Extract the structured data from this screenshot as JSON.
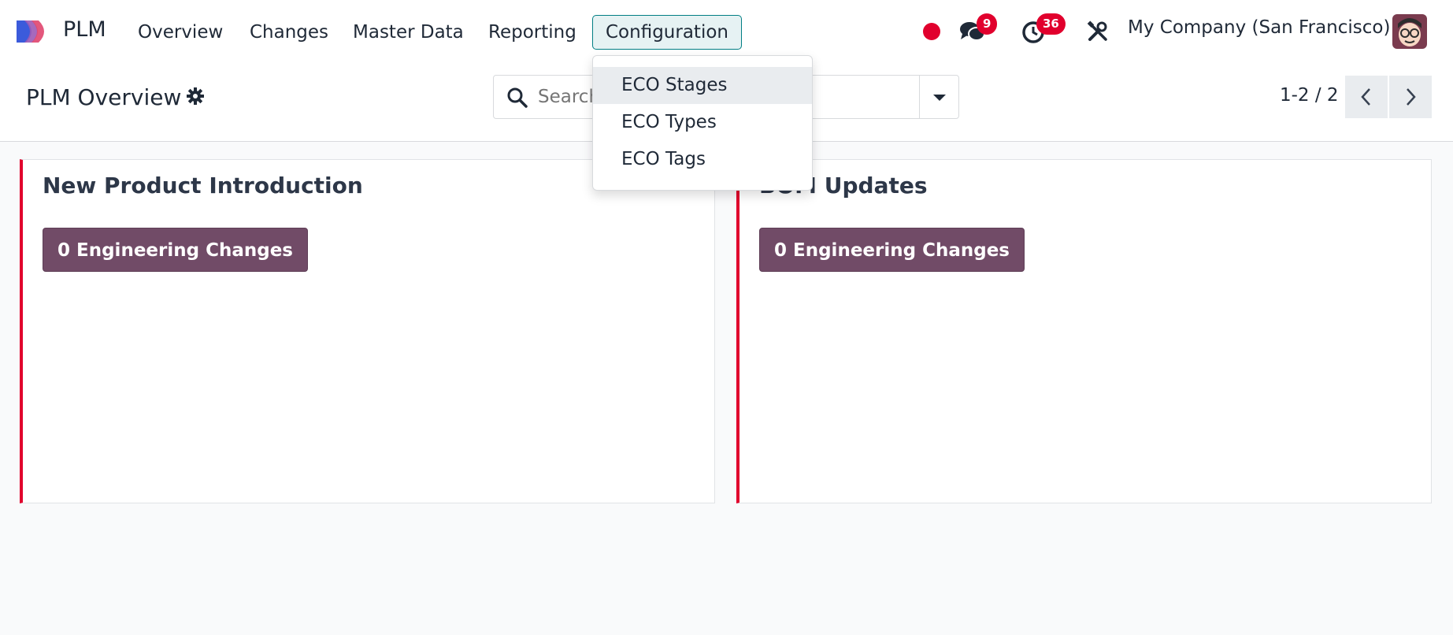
{
  "app": {
    "name": "PLM",
    "brand_colors": [
      "#e0456e",
      "#9b59b6",
      "#3498db"
    ]
  },
  "navbar": {
    "menu": [
      {
        "label": "Overview"
      },
      {
        "label": "Changes"
      },
      {
        "label": "Master Data"
      },
      {
        "label": "Reporting"
      },
      {
        "label": "Configuration",
        "active": true
      }
    ],
    "status_dot_color": "#e1002d",
    "messages_badge": "9",
    "activities_badge": "36",
    "company": "My Company (San Francisco)",
    "icons": [
      "status-dot-icon",
      "chat-icon",
      "clock-icon",
      "tools-icon",
      "avatar"
    ]
  },
  "control_panel": {
    "title": "PLM Overview",
    "search_placeholder": "Search...",
    "pager": "1-2 / 2"
  },
  "configuration_menu": {
    "items": [
      {
        "label": "ECO Stages",
        "highlighted": true
      },
      {
        "label": "ECO Types"
      },
      {
        "label": "ECO Tags"
      }
    ]
  },
  "cards": [
    {
      "title": "New Product Introduction",
      "button": "0 Engineering Changes",
      "accent": "#e1002d"
    },
    {
      "title": "BOM Updates",
      "button": "0 Engineering Changes",
      "accent": "#e1002d"
    }
  ],
  "colors": {
    "primary": "#714b67",
    "accent_teal": "#017e84",
    "badge_red": "#e1002d"
  }
}
